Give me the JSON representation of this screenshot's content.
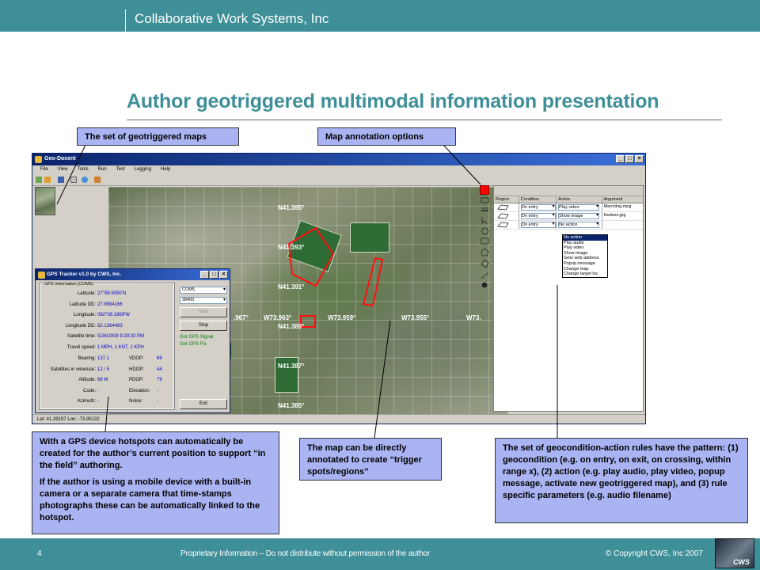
{
  "header": {
    "company": "Collaborative Work Systems, Inc"
  },
  "title": "Author geotriggered multimodal information presentation",
  "callouts": {
    "maps": "The set of geotriggered maps",
    "annotation": "Map annotation options",
    "gps_p1": "With a GPS device hotspots can automatically be created for the author’s current position to support “in the field” authoring.",
    "gps_p2": "If the author is using a mobile device with a built-in camera or a separate camera that time-stamps photographs these can be automatically linked to the hotspot.",
    "map_annot": "The map can be directly annotated to create “trigger spots/regions”",
    "rules": "The set of geocondition-action rules have the pattern: (1) geocondition (e.g. on entry, on exit, on crossing, within range x), (2) action (e.g. play audio, play video, popup message, activate new geotriggered map), and (3) rule specific parameters (e.g. audio filename)"
  },
  "app": {
    "title": "Geo-Docent",
    "menu": [
      "File",
      "View",
      "Tools",
      "Run",
      "Test",
      "Logging",
      "Help"
    ],
    "map_coords": [
      {
        "label": "N41.395°"
      },
      {
        "label": "N41.393°"
      },
      {
        "label": "N41.391°"
      },
      {
        "label": "N41.389°"
      },
      {
        "label": "N41.387°"
      },
      {
        "label": "N41.385°"
      },
      {
        "label": ".967°"
      },
      {
        "label": "W73.963°"
      },
      {
        "label": "W73.959°"
      },
      {
        "label": "W73.955°"
      },
      {
        "label": "W73."
      }
    ],
    "rules": {
      "headers": [
        "Region",
        "Condition",
        "Action",
        "Argument"
      ],
      "rows": [
        {
          "condition": "On entry",
          "action": "Play video",
          "argument": "Marching.mpg"
        },
        {
          "condition": "On entry",
          "action": "Show image",
          "argument": "Hudson.jpg"
        },
        {
          "condition": "On entry",
          "action": "No action",
          "argument": ""
        }
      ],
      "dropdown": [
        "No action",
        "Play audio",
        "Play video",
        "Show image",
        "Goto web address",
        "Popup message",
        "Change map",
        "Change target loc"
      ]
    },
    "status": "Lat: 41.39197   Lon: -73.95132"
  },
  "gps": {
    "title": "GPS Tracker v1.0 by CWS, Inc.",
    "group_label": "GPS Information (COM5)",
    "fields": [
      {
        "k": "Latitude:",
        "v": "27°59.9050'N"
      },
      {
        "k": "Latitude DD:",
        "v": "27.9984166"
      },
      {
        "k": "Longitude:",
        "v": "082°08.1869'W"
      },
      {
        "k": "Longitude DD:",
        "v": "82.1364483"
      },
      {
        "k": "Satellite time:",
        "v": "5/26/2008 9:29:33 PM"
      },
      {
        "k": "Travel speed:",
        "v": "1 MPH, 1 KNT, 1 KPH"
      }
    ],
    "pairs": [
      {
        "k": "Bearing:",
        "v": "137.1",
        "k2": "VDOP:",
        "v2": "66"
      },
      {
        "k": "Satellites in view/use:",
        "v": "12  /  5",
        "k2": "HDOP:",
        "v2": "44"
      },
      {
        "k": "Altitude:",
        "v": "68 M",
        "k2": "PDOP:",
        "v2": "79"
      },
      {
        "k": "Code:",
        "v": "-",
        "k2": "Elevation:",
        "v2": "-"
      },
      {
        "k": "Azimuth:",
        "v": "-",
        "k2": "Noise:",
        "v2": "-"
      }
    ],
    "port": "COM5",
    "baud": "38400",
    "start": "Start",
    "stop": "Stop",
    "signal": "Got GPS Signal",
    "fix": "Got GPS Fix",
    "exit": "Exit"
  },
  "footer": {
    "page": "4",
    "notice": "Proprietary Information – Do not distribute without permission of the author",
    "copyright": "© Copyright CWS, Inc 2007",
    "logo": "CWS"
  },
  "colors": {
    "teal": "#3f8f99",
    "callout": "#aab4f2",
    "annotation_red": "#ff0000"
  }
}
